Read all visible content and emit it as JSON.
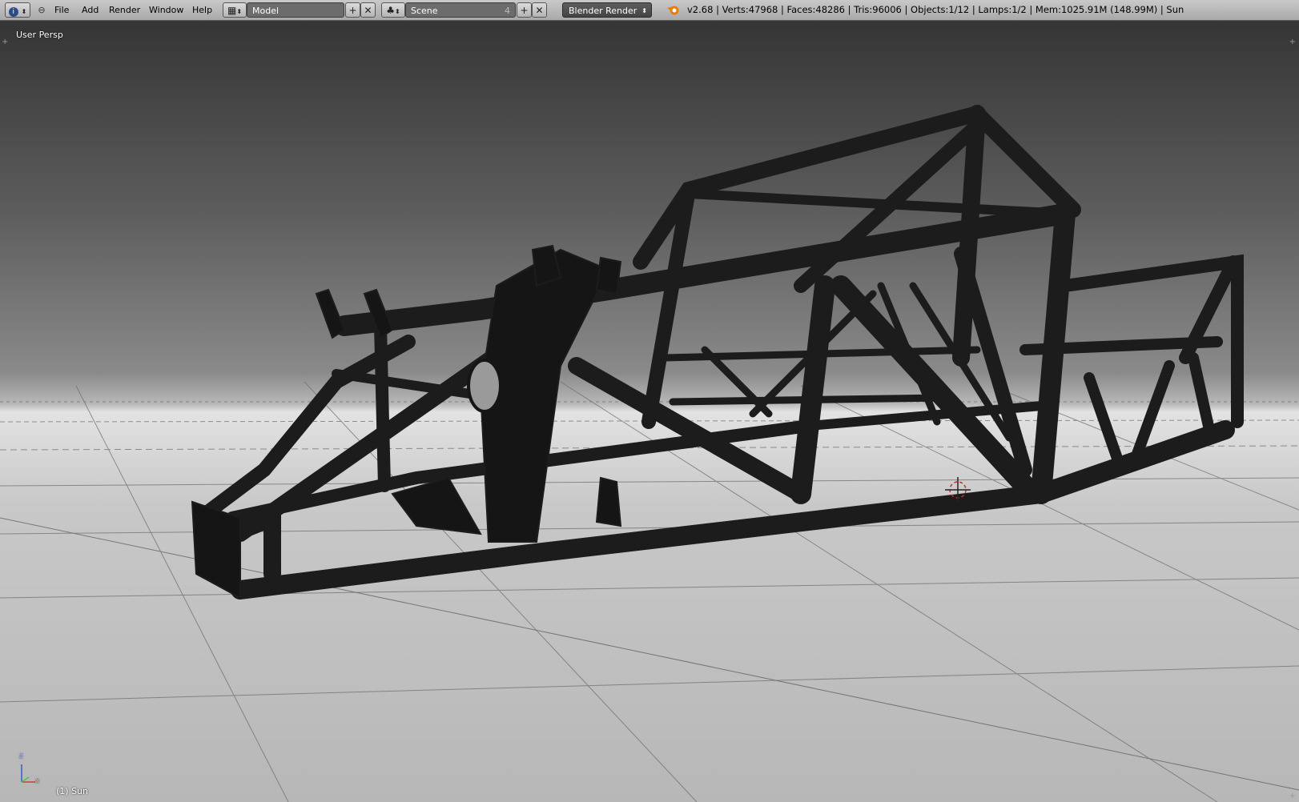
{
  "header": {
    "editor_type_icon": "info-icon",
    "menus": [
      "File",
      "Add",
      "Render",
      "Window",
      "Help"
    ],
    "screen_layout": {
      "icon": "screen-layout-icon",
      "value": "Model"
    },
    "scene": {
      "icon": "scene-icon",
      "value": "Scene",
      "users": "4"
    },
    "render_engine": "Blender Render",
    "status": "v2.68 | Verts:47968 | Faces:48286 | Tris:96006 | Objects:1/12 | Lamps:1/2 | Mem:1025.91M (148.99M) | Sun"
  },
  "viewport": {
    "view_name": "User Persp",
    "active_object": "(1) Sun",
    "axis_labels": {
      "z": "z",
      "x": "x"
    }
  },
  "colors": {
    "header_bg": "#b4b4b4",
    "field_bg": "#6c6c6c",
    "frame_tube": "#1c1c1c",
    "cursor_red": "#c83030"
  }
}
